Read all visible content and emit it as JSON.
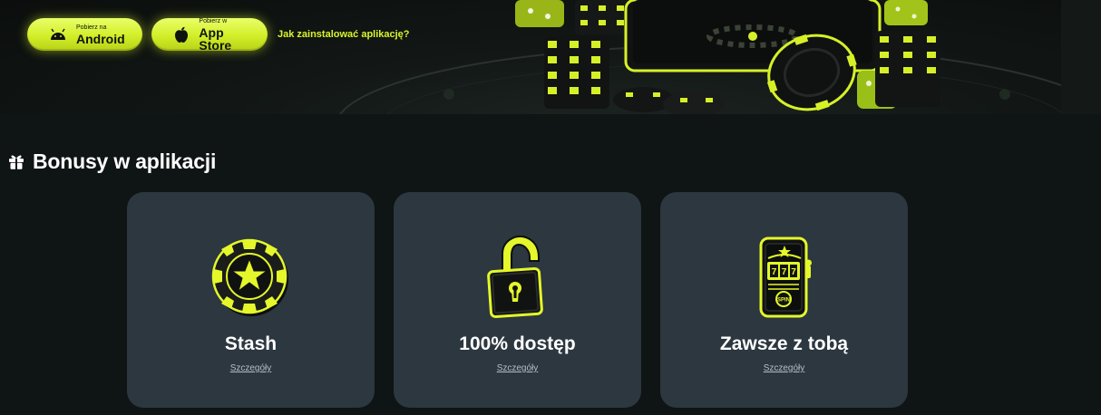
{
  "hero": {
    "android_button": {
      "small": "Pobierz na",
      "big": "Android",
      "icon": "android-icon"
    },
    "appstore_button": {
      "small": "Pobierz w",
      "big": "App Store",
      "icon": "apple-icon"
    },
    "howto_link": "Jak zainstalować aplikację?"
  },
  "bonuses": {
    "title": "Bonusy w aplikacji",
    "icon": "gift-icon",
    "cards": [
      {
        "title": "Stash",
        "link": "Szczegóły",
        "icon": "poker-chip-star-icon"
      },
      {
        "title": "100% dostęp",
        "link": "Szczegóły",
        "icon": "open-padlock-icon"
      },
      {
        "title": "Zawsze z tobą",
        "link": "Szczegóły",
        "icon": "phone-slot-icon",
        "icon_text": "SPIN"
      }
    ]
  },
  "colors": {
    "accent": "#d6f028",
    "background": "#0f1414",
    "card": "#2c3740",
    "link": "#b6bec4"
  }
}
